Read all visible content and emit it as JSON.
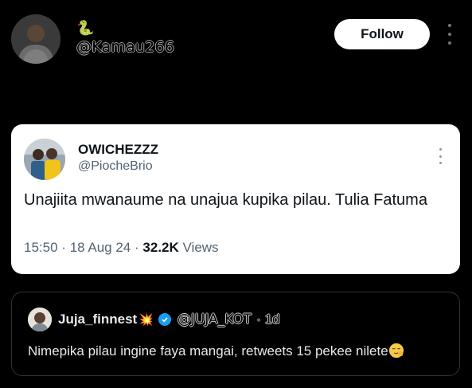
{
  "header": {
    "emoji": "🐍",
    "handle": "@Kamau266",
    "follow_label": "Follow"
  },
  "quoted_tweet": {
    "name": "OWICHEZZZ",
    "handle": "@PiocheBrio",
    "text": "Unajiita mwanaume na unajua kupika pilau. Tulia Fatuma",
    "time": "15:50",
    "date": "18 Aug 24",
    "views_count": "32.2K",
    "views_label": "Views",
    "separator": "·"
  },
  "reply": {
    "name": "Juja_finnest",
    "name_emoji": "💥",
    "handle": "@JUJA_KOT",
    "time": "· 1d",
    "text": "Nimepika pilau ingine faya mangai, retweets 15 pekee nilete"
  },
  "colors": {
    "background": "#000000",
    "card_bg": "#ffffff",
    "verified": "#1d9bf0",
    "muted": "#536471"
  }
}
